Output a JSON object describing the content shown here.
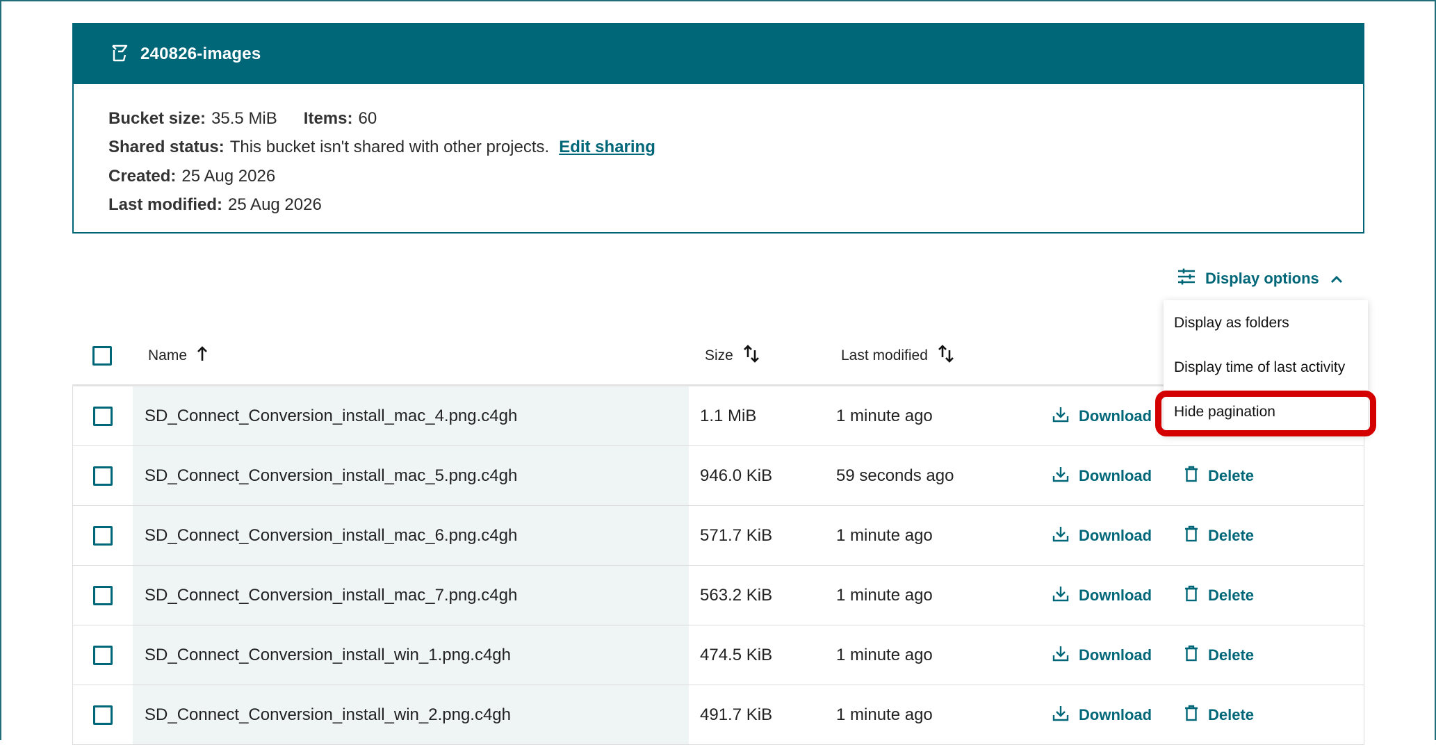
{
  "bucket": {
    "name": "240826-images",
    "size_label": "Bucket size:",
    "size_value": "35.5 MiB",
    "items_label": "Items:",
    "items_value": "60",
    "shared_label": "Shared status:",
    "shared_value": "This bucket isn't shared with other projects.",
    "edit_sharing": "Edit sharing",
    "created_label": "Created:",
    "created_value": "25 Aug 2026",
    "modified_label": "Last modified:",
    "modified_value": "25 Aug 2026"
  },
  "display_options": {
    "label": "Display options",
    "menu": [
      "Display as folders",
      "Display time of last activity",
      "Hide pagination"
    ],
    "highlighted_item": "Hide pagination"
  },
  "table": {
    "headers": {
      "name": "Name",
      "size": "Size",
      "modified": "Last modified"
    },
    "download_label": "Download",
    "delete_label": "Delete",
    "rows": [
      {
        "name": "SD_Connect_Conversion_install_mac_4.png.c4gh",
        "size": "1.1 MiB",
        "modified": "1 minute ago"
      },
      {
        "name": "SD_Connect_Conversion_install_mac_5.png.c4gh",
        "size": "946.0 KiB",
        "modified": "59 seconds ago"
      },
      {
        "name": "SD_Connect_Conversion_install_mac_6.png.c4gh",
        "size": "571.7 KiB",
        "modified": "1 minute ago"
      },
      {
        "name": "SD_Connect_Conversion_install_mac_7.png.c4gh",
        "size": "563.2 KiB",
        "modified": "1 minute ago"
      },
      {
        "name": "SD_Connect_Conversion_install_win_1.png.c4gh",
        "size": "474.5 KiB",
        "modified": "1 minute ago"
      },
      {
        "name": "SD_Connect_Conversion_install_win_2.png.c4gh",
        "size": "491.7 KiB",
        "modified": "1 minute ago"
      }
    ]
  },
  "colors": {
    "accent": "#006778",
    "highlight": "#d40000",
    "name_cell_bg": "#eff5f5"
  }
}
